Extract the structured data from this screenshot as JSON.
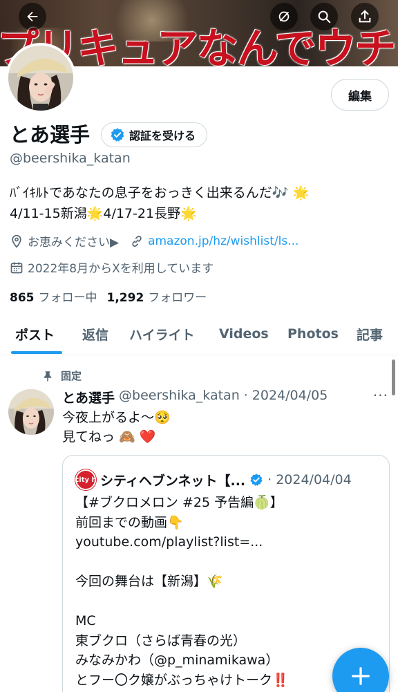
{
  "banner": {
    "text": "プリキュアなんでウチら"
  },
  "profile": {
    "edit_label": "編集",
    "name": "とあ選手",
    "verify_label": "認証を受ける",
    "handle": "@beershika_katan",
    "bio_line1": "ﾊﾞｲｷﾙﾄであなたの息子をおっきく出来るんだ🎶 🌟",
    "bio_line2": "4/11-15新潟🌟4/17-21長野🌟",
    "location": "お恵みください▶",
    "link": "amazon.jp/hz/wishlist/ls...",
    "joined": "2022年8月からXを利用しています",
    "following_count": "865",
    "following_label": "フォロー中",
    "followers_count": "1,292",
    "followers_label": "フォロワー"
  },
  "tabs": [
    "ポスト",
    "返信",
    "ハイライト",
    "Videos",
    "Photos",
    "記事"
  ],
  "post": {
    "pinned_label": "固定",
    "author_name": "とあ選手",
    "author_handle": "@beershika_katan",
    "separator": "·",
    "date": "2024/04/05",
    "more": "···",
    "text_line1": "今夜上がるよ〜🥺",
    "text_line2": "見てねっ 🙈 ❤️",
    "quote": {
      "logo_text": "city h",
      "author_name": "シティヘブンネット【...",
      "separator": "·",
      "date": "2024/04/04",
      "body": "【#ブクロメロン #25 予告編🍈】\n前回までの動画👇\nyoutube.com/playlist?list=...\n\n今回の舞台は【新潟】🌾\n\nMC\n東ブクロ（さらば青春の光）\nみなみかわ（@p_minamikawa）\nとフー〇ク嬢がぶっちゃけトーク‼️"
    }
  },
  "colors": {
    "accent": "#1d9bf0",
    "text": "#0f1419",
    "muted": "#536471",
    "banner_text": "#c8101e"
  },
  "icons": [
    "back-arrow-icon",
    "no-notify-icon",
    "search-icon",
    "share-icon",
    "verified-badge-icon",
    "location-icon",
    "link-icon",
    "calendar-icon",
    "pin-icon",
    "compose-plus-icon"
  ]
}
